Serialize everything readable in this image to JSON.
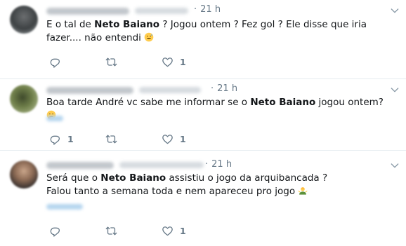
{
  "tweets": [
    {
      "time": "21 h",
      "text_pre": "E o tal de ",
      "text_bold": "Neto Baiano",
      "text_post": " ? Jogou ontem ? Fez gol ? Ele disse que iria fazer.... não entendi",
      "emoji": "sweat-smile-emoji",
      "replies": "",
      "likes": "1"
    },
    {
      "time": "21 h",
      "text_pre": "Boa tarde André vc sabe me informar se o ",
      "text_bold": "Neto Baiano",
      "text_post": " jogou ontem?",
      "emoji": "thinking-face-emoji",
      "replies": "1",
      "likes": "1"
    },
    {
      "time": "21 h",
      "text_pre": "Será que o ",
      "text_bold": "Neto Baiano",
      "text_post": " assistiu o jogo da arquibancada ?",
      "text_line2": "Falou tanto a semana toda e nem apareceu pro jogo",
      "emoji": "person-shrugging-emoji",
      "replies": "",
      "likes": "1"
    }
  ],
  "icons": {
    "reply": "reply-icon",
    "retweet": "retweet-icon",
    "like": "heart-icon",
    "more": "chevron-down-icon"
  },
  "colors": {
    "text": "#14171a",
    "muted": "#657786",
    "divider": "#e6ecf0",
    "emoji": "#ffcc4d"
  }
}
